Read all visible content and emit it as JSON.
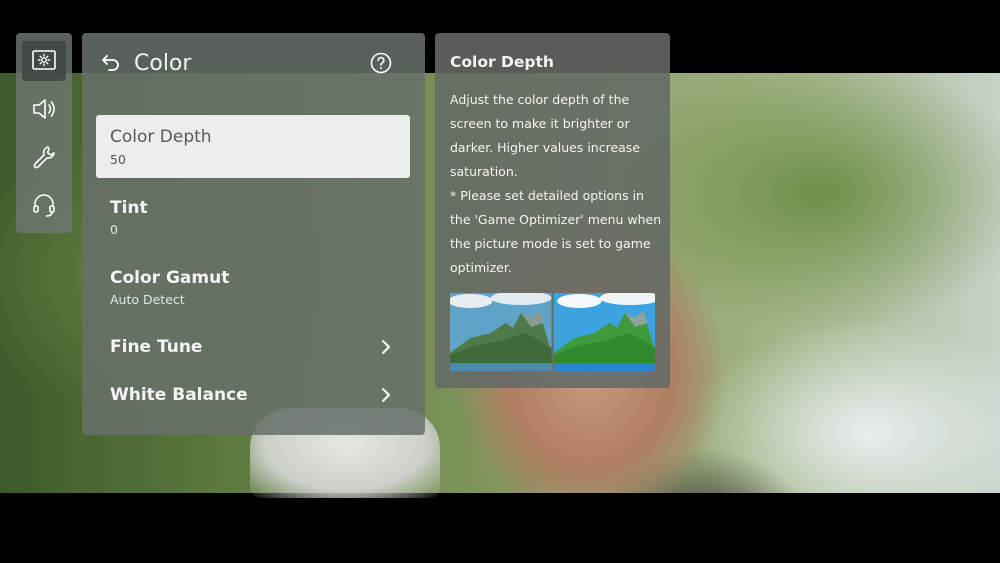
{
  "sidebar": {
    "items": [
      {
        "name": "picture",
        "icon": "picture-settings-icon",
        "active": true
      },
      {
        "name": "sound",
        "icon": "speaker-icon",
        "active": false
      },
      {
        "name": "general",
        "icon": "wrench-icon",
        "active": false
      },
      {
        "name": "support",
        "icon": "headset-icon",
        "active": false
      }
    ]
  },
  "panel": {
    "title": "Color",
    "back_icon": "back-arrow-icon",
    "help_icon": "help-icon",
    "items": [
      {
        "label": "Color Depth",
        "value": "50",
        "selected": true
      },
      {
        "label": "Tint",
        "value": "0"
      },
      {
        "label": "Color Gamut",
        "value": "Auto Detect"
      },
      {
        "label": "Fine Tune",
        "value": "",
        "has_submenu": true
      },
      {
        "label": "White Balance",
        "value": "",
        "has_submenu": true
      }
    ]
  },
  "description": {
    "title": "Color Depth",
    "body": "Adjust the color depth of the\nscreen to make it brighter or\ndarker. Higher values increase\nsaturation.\n* Please set detailed options in\nthe 'Game Optimizer' menu when\nthe picture mode is set to game\noptimizer."
  },
  "colors": {
    "panel_bg": "#687068",
    "selected_bg": "#eceeec",
    "text": "#f4f4f4"
  }
}
